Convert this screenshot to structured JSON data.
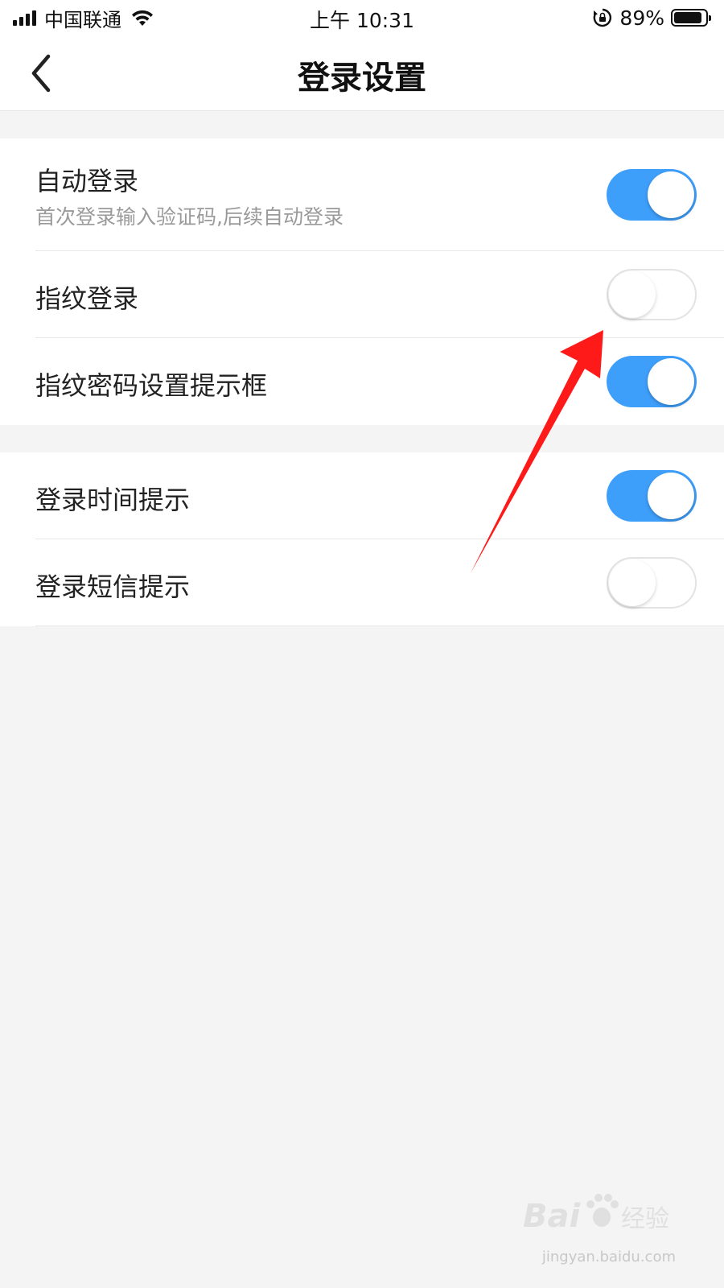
{
  "status_bar": {
    "carrier": "中国联通",
    "time": "上午 10:31",
    "battery_percent": "89%",
    "battery_level": 0.89
  },
  "nav": {
    "title": "登录设置",
    "back_icon": "chevron-left-icon"
  },
  "colors": {
    "toggle_on": "#3e9ffb",
    "annotation": "#ff1a1a"
  },
  "group1": [
    {
      "title": "自动登录",
      "subtitle": "首次登录输入验证码,后续自动登录",
      "on": true
    },
    {
      "title": "指纹登录",
      "on": false
    },
    {
      "title": "指纹密码设置提示框",
      "on": true
    }
  ],
  "group2": [
    {
      "title": "登录时间提示",
      "on": true
    },
    {
      "title": "登录短信提示",
      "on": false
    }
  ],
  "watermark": {
    "logo_text": "Bai",
    "logo_suffix": "经验",
    "url": "jingyan.baidu.com"
  }
}
